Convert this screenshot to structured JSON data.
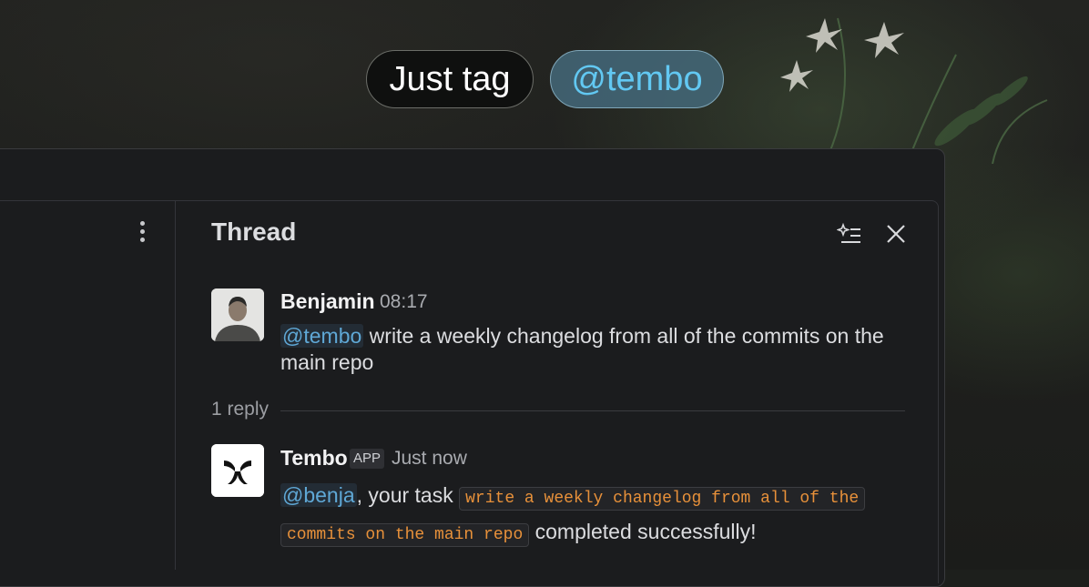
{
  "hero": {
    "pill_1": "Just tag",
    "pill_2": "@tembo"
  },
  "thread": {
    "title": "Thread",
    "message_1": {
      "author": "Benjamin",
      "time": "08:17",
      "mention": "@tembo",
      "text": " write a weekly changelog from all of the commits on the main repo"
    },
    "replies_label": "1 reply",
    "message_2": {
      "author": "Tembo",
      "badge": "APP",
      "time": "Just now",
      "mention": "@benja",
      "text_before": ", your task ",
      "code_1": "write a weekly changelog from all of the",
      "code_2": "commits on the main repo",
      "text_after": " completed successfully!"
    }
  },
  "colors": {
    "mention": "#5fa8d6",
    "code": "#e8913a",
    "pill_accent": "#62c8f2"
  },
  "icons": [
    "more-vertical-icon",
    "ai-summary-icon",
    "close-icon"
  ]
}
